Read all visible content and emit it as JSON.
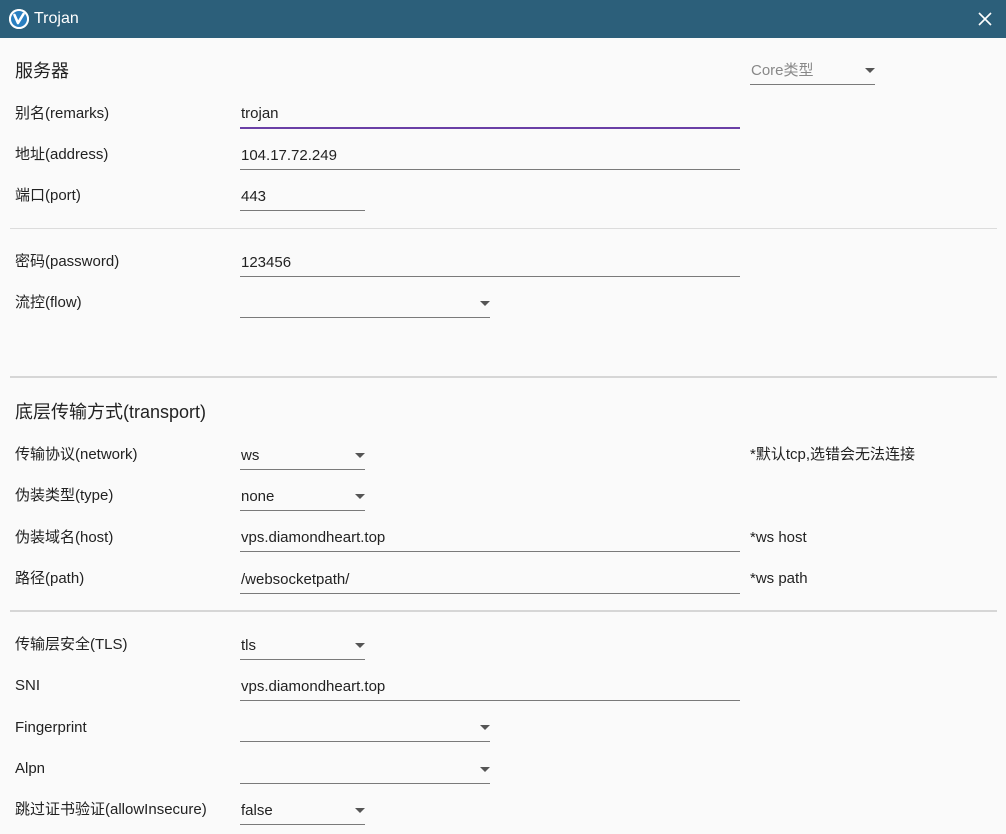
{
  "window": {
    "title": "Trojan",
    "close_icon": "close-icon",
    "logo_icon": "v-logo-icon"
  },
  "server_section": {
    "title": "服务器",
    "core_type": {
      "placeholder": "Core类型",
      "value": ""
    },
    "remarks": {
      "label": "别名(remarks)",
      "value": "trojan"
    },
    "address": {
      "label": "地址(address)",
      "value": "104.17.72.249"
    },
    "port": {
      "label": "端口(port)",
      "value": "443"
    },
    "password": {
      "label": "密码(password)",
      "value": "123456"
    },
    "flow": {
      "label": "流控(flow)",
      "value": ""
    }
  },
  "transport_section": {
    "title": "底层传输方式(transport)",
    "network": {
      "label": "传输协议(network)",
      "value": "ws",
      "hint": "*默认tcp,选错会无法连接"
    },
    "type": {
      "label": "伪装类型(type)",
      "value": "none"
    },
    "host": {
      "label": "伪装域名(host)",
      "value": "vps.diamondheart.top",
      "hint": "*ws host"
    },
    "path": {
      "label": "路径(path)",
      "value": "/websocketpath/",
      "hint": "*ws path"
    }
  },
  "tls_section": {
    "tls": {
      "label": "传输层安全(TLS)",
      "value": "tls"
    },
    "sni": {
      "label": "SNI",
      "value": "vps.diamondheart.top"
    },
    "fingerprint": {
      "label": "Fingerprint",
      "value": ""
    },
    "alpn": {
      "label": "Alpn",
      "value": ""
    },
    "allow_insecure": {
      "label": "跳过证书验证(allowInsecure)",
      "value": "false"
    }
  },
  "colors": {
    "titlebar": "#2c5f7a",
    "focus_underline": "#6a3fa6",
    "background": "#fafafa"
  }
}
